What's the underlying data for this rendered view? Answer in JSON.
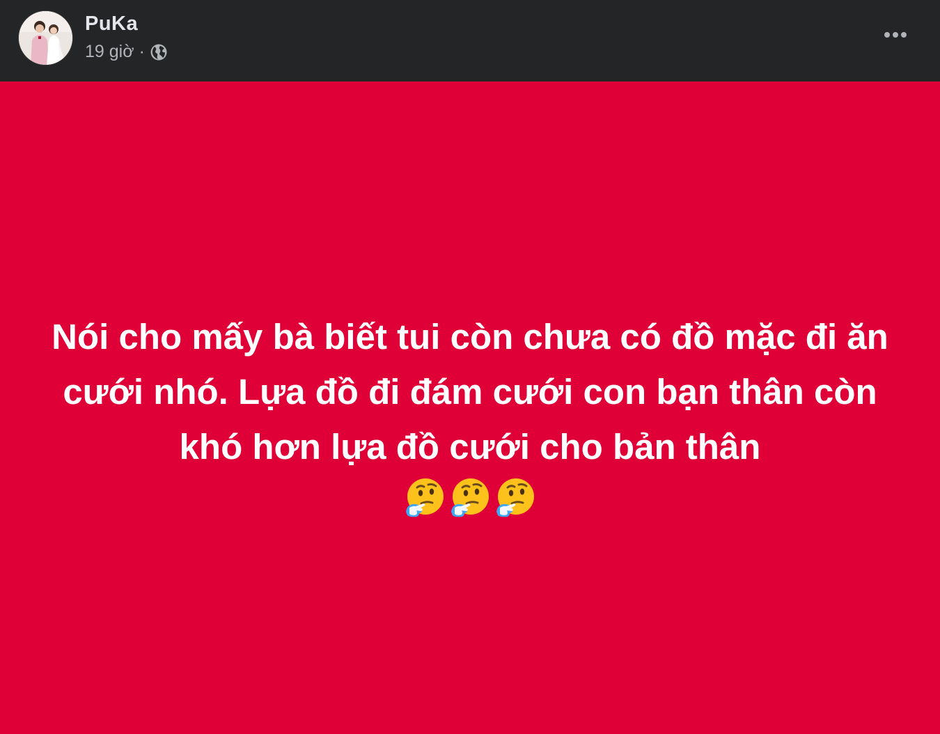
{
  "post": {
    "author": "PuKa",
    "timestamp": "19 giờ",
    "separator": "·",
    "privacy_icon": "globe-icon",
    "more_icon": "more-options-icon",
    "background_color": "#df0037",
    "text": "Nói cho mấy bà biết tui còn chưa có đồ mặc đi ăn cưới nhó. Lựa đồ đi đám cưới con bạn thân còn khó hơn lựa đồ cưới cho bản thân",
    "emojis": [
      "thinking-face-emoji",
      "thinking-face-emoji",
      "thinking-face-emoji"
    ]
  }
}
